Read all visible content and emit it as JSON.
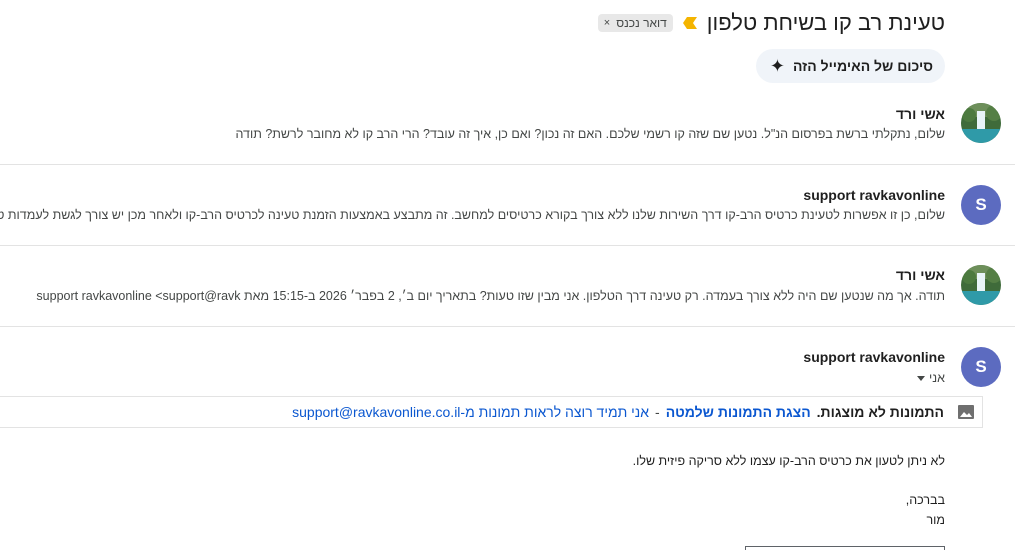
{
  "thread": {
    "subject": "טעינת רב קו בשיחת טלפון",
    "label": "דואר נכנס",
    "label_remove": "×",
    "summary_button": "סיכום של האימייל הזה"
  },
  "messages": [
    {
      "sender": "אשי ורד",
      "snippet": "שלום, נתקלתי ברשת בפרסום הנ\"ל. נטען שם שזה קו רשמי שלכם. האם זה נכון? ואם כן, איך זה עובד? הרי הרב קו לא מחובר לרשת? תודה"
    },
    {
      "sender": "support ravkavonline",
      "avatar_letter": "S",
      "snippet": "שלום, כן זו אפשרות לטעינת כרטיס הרב-קו דרך השירות שלנו ללא צורך בקורא כרטיסים למחשב. זה מתבצע באמצעות הזמנת טעינה לכרטיס הרב-קו ולאחר מכן יש צורך לגשת לעמדות טע"
    },
    {
      "sender": "אשי ורד",
      "snippet": "תודה. אך מה שנטען שם היה ללא צורך בעמדה. רק טעינה דרך הטלפון. אני מבין שזו טעות? בתאריך יום ב׳, 2 בפבר׳ 2026 ב-15:15 מאת support ravkavonline <support@ravk"
    },
    {
      "sender": "support ravkavonline",
      "avatar_letter": "S",
      "recipient": "אני"
    }
  ],
  "images_notice": {
    "lead": "התמונות לא מוצגות.",
    "show_link": "הצגת התמונות שלמטה",
    "dash": "-",
    "always_link": "אני תמיד רוצה לראות תמונות מ-support@ravkavonline.co.il"
  },
  "body": {
    "line1": "לא ניתן לטעון את כרטיס הרב-קו עצמו ללא סריקה פיזית שלו.",
    "greeting": "בברכה,",
    "signature": "מור"
  },
  "colors": {
    "accent": "#0b57d0",
    "avatar_bg": "#5c6bc0",
    "importance": "#f4b400"
  },
  "icons": {
    "importance": "importance-marker-icon",
    "sparkle": "sparkle-icon",
    "image": "image-icon",
    "dropdown": "chevron-down-icon"
  }
}
